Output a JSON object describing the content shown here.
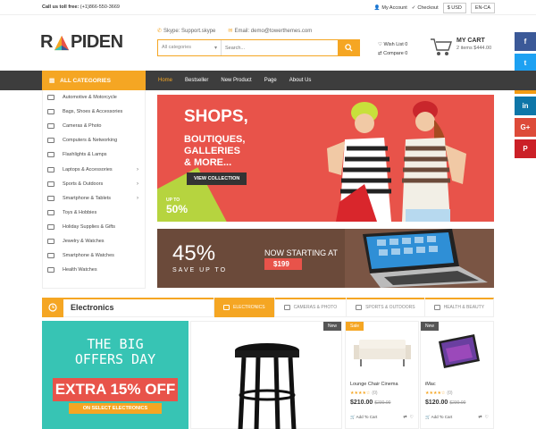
{
  "topbar": {
    "call_label": "Call us toll free:",
    "call_number": "(+1)866-550-3669",
    "my_account": "My Account",
    "checkout": "Checkout",
    "currency": "USD",
    "language": "EN-CA"
  },
  "header": {
    "logo_part1": "R",
    "logo_part2": "PIDEN",
    "skype": "Skype: Support.skype",
    "email": "Email: demo@towerthemes.com",
    "search_category": "All categories",
    "search_placeholder": "Search...",
    "wishlist": "Wish List 0",
    "compare": "Compare 0",
    "cart_title": "MY CART",
    "cart_sub": "2 items $444.00"
  },
  "social": [
    {
      "name": "facebook",
      "glyph": "f",
      "color": "#3b5998"
    },
    {
      "name": "twitter",
      "glyph": "t",
      "color": "#1da1f2"
    },
    {
      "name": "rss",
      "glyph": "≋",
      "color": "#f39c12"
    },
    {
      "name": "linkedin",
      "glyph": "in",
      "color": "#0e76a8"
    },
    {
      "name": "googleplus",
      "glyph": "G+",
      "color": "#dd4b39"
    },
    {
      "name": "pinterest",
      "glyph": "P",
      "color": "#cb2027"
    }
  ],
  "nav": {
    "all_categories": "ALL CATEGORIES",
    "links": [
      "Home",
      "Bestseller",
      "New Product",
      "Page",
      "About Us"
    ]
  },
  "sidebar": {
    "items": [
      {
        "label": "Automotive & Motorcycle",
        "arrow": false
      },
      {
        "label": "Bags, Shoes & Accessories",
        "arrow": false
      },
      {
        "label": "Cameras & Photo",
        "arrow": false
      },
      {
        "label": "Computers & Networking",
        "arrow": false
      },
      {
        "label": "Flashlights & Lamps",
        "arrow": false
      },
      {
        "label": "Laptops & Accessories",
        "arrow": true
      },
      {
        "label": "Sports & Outdoors",
        "arrow": true
      },
      {
        "label": "Smartphone & Tablets",
        "arrow": true
      },
      {
        "label": "Toys & Hobbies",
        "arrow": false
      },
      {
        "label": "Holiday Supplies & Gifts",
        "arrow": false
      },
      {
        "label": "Jewelry & Watches",
        "arrow": false
      },
      {
        "label": "Smartphone & Watches",
        "arrow": false
      },
      {
        "label": "Health Watches",
        "arrow": false
      }
    ]
  },
  "banner1": {
    "title": "SHOPS,",
    "sub1": "BOUTIQUES,",
    "sub2": "GALLERIES",
    "sub3": "& MORE...",
    "button": "VIEW COLLECTION",
    "upto": "UP TO",
    "percent": "50%"
  },
  "banner2": {
    "percent": "45%",
    "save": "SAVE UP TO",
    "now": "NOW STARTING AT",
    "price": "$199"
  },
  "section": {
    "title": "Electronics",
    "tabs": [
      "ELECTRONICS",
      "CAMERAS & PHOTO",
      "SPORTS & OUTDOORS",
      "HEALTH & BEAUTY"
    ]
  },
  "promo": {
    "line1": "THE BIG",
    "line2": "OFFERS DAY",
    "ribbon": "EXTRA 15% OFF",
    "sub": "ON SELECT ELECTRONICS"
  },
  "products": [
    {
      "badge": "New",
      "name": "",
      "price": "",
      "old": ""
    },
    {
      "badge": "Sale",
      "name": "Lounge Chair Cinema",
      "stars": "★★★★☆",
      "reviews": "(0)",
      "price": "$210.00",
      "old": "$230.00",
      "add": "Add To Cart"
    },
    {
      "badge": "New",
      "name": "iMac",
      "stars": "★★★★☆",
      "reviews": "(0)",
      "price": "$120.00",
      "old": "$230.00",
      "add": "Add To Cart"
    }
  ],
  "colors": {
    "accent": "#f5a623",
    "nav_bg": "#3d3d3d",
    "banner_red": "#e8534a",
    "promo_teal": "#37c4b4"
  }
}
